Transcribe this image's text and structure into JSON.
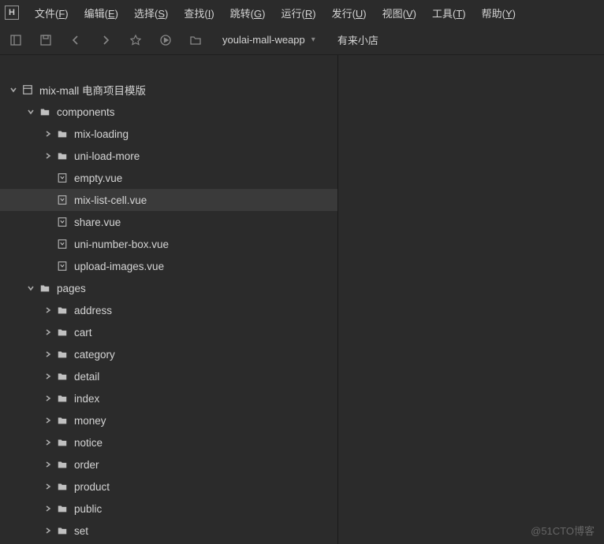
{
  "menu": {
    "items": [
      {
        "label": "文件",
        "key": "F"
      },
      {
        "label": "编辑",
        "key": "E"
      },
      {
        "label": "选择",
        "key": "S"
      },
      {
        "label": "查找",
        "key": "I"
      },
      {
        "label": "跳转",
        "key": "G"
      },
      {
        "label": "运行",
        "key": "R"
      },
      {
        "label": "发行",
        "key": "U"
      },
      {
        "label": "视图",
        "key": "V"
      },
      {
        "label": "工具",
        "key": "T"
      },
      {
        "label": "帮助",
        "key": "Y"
      }
    ]
  },
  "toolbar": {
    "project_name": "youlai-mall-weapp",
    "device_label": "有来小店"
  },
  "tree": [
    {
      "depth": 0,
      "label": "mix-mall 电商项目模版",
      "icon": "project",
      "chevron": "down"
    },
    {
      "depth": 1,
      "label": "components",
      "icon": "folder",
      "chevron": "down"
    },
    {
      "depth": 2,
      "label": "mix-loading",
      "icon": "folder",
      "chevron": "right"
    },
    {
      "depth": 2,
      "label": "uni-load-more",
      "icon": "folder",
      "chevron": "right"
    },
    {
      "depth": 2,
      "label": "empty.vue",
      "icon": "vue",
      "chevron": "none"
    },
    {
      "depth": 2,
      "label": "mix-list-cell.vue",
      "icon": "vue",
      "chevron": "none",
      "selected": true
    },
    {
      "depth": 2,
      "label": "share.vue",
      "icon": "vue",
      "chevron": "none"
    },
    {
      "depth": 2,
      "label": "uni-number-box.vue",
      "icon": "vue",
      "chevron": "none"
    },
    {
      "depth": 2,
      "label": "upload-images.vue",
      "icon": "vue",
      "chevron": "none"
    },
    {
      "depth": 1,
      "label": "pages",
      "icon": "folder",
      "chevron": "down"
    },
    {
      "depth": 2,
      "label": "address",
      "icon": "folder",
      "chevron": "right"
    },
    {
      "depth": 2,
      "label": "cart",
      "icon": "folder",
      "chevron": "right"
    },
    {
      "depth": 2,
      "label": "category",
      "icon": "folder",
      "chevron": "right"
    },
    {
      "depth": 2,
      "label": "detail",
      "icon": "folder",
      "chevron": "right"
    },
    {
      "depth": 2,
      "label": "index",
      "icon": "folder",
      "chevron": "right"
    },
    {
      "depth": 2,
      "label": "money",
      "icon": "folder",
      "chevron": "right"
    },
    {
      "depth": 2,
      "label": "notice",
      "icon": "folder",
      "chevron": "right"
    },
    {
      "depth": 2,
      "label": "order",
      "icon": "folder",
      "chevron": "right"
    },
    {
      "depth": 2,
      "label": "product",
      "icon": "folder",
      "chevron": "right"
    },
    {
      "depth": 2,
      "label": "public",
      "icon": "folder",
      "chevron": "right"
    },
    {
      "depth": 2,
      "label": "set",
      "icon": "folder",
      "chevron": "right"
    }
  ],
  "watermark": "@51CTO博客"
}
